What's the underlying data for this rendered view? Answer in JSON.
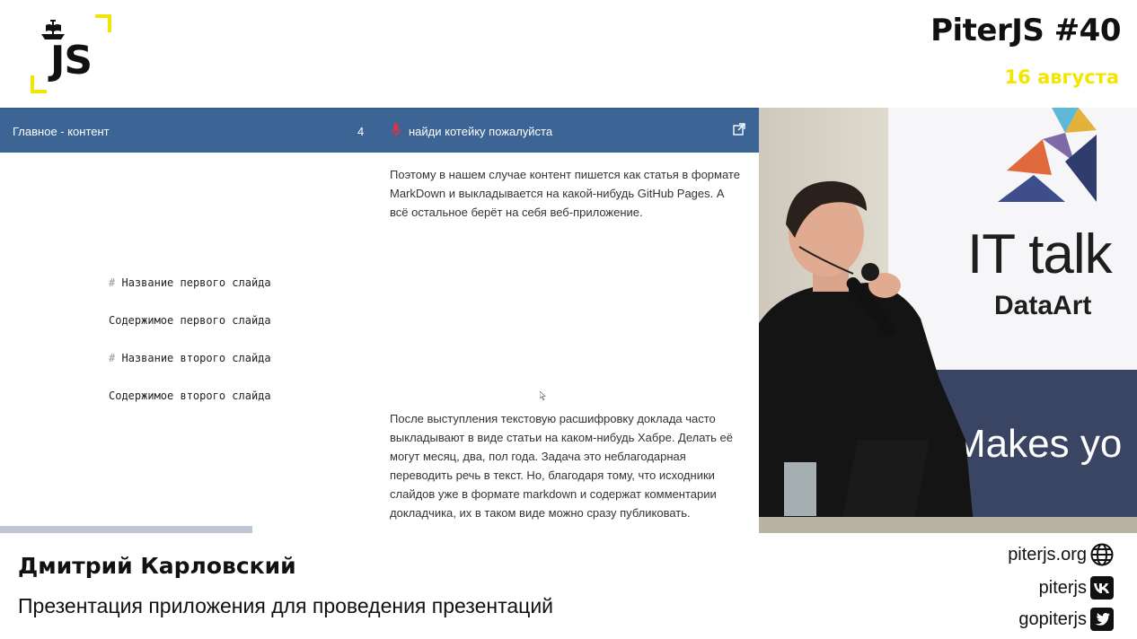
{
  "header": {
    "logo_text": "JS",
    "event_title": "PiterJS #40",
    "event_date": "16 августа"
  },
  "app": {
    "section_title": "Главное - контент",
    "slide_count": "4",
    "topic": "найди котейку пожалуйста",
    "slide_lines": [
      {
        "hash": "#",
        "text": "Название первого слайда"
      },
      {
        "hash": "",
        "text": "Содержимое первого слайда"
      },
      {
        "hash": "#",
        "text": "Название второго слайда"
      },
      {
        "hash": "",
        "text": "Содержимое второго слайда"
      }
    ],
    "notes": [
      "Поэтому в нашем случае контент пишется как статья в формате MarkDown и выкладывается на какой-нибудь GitHub Pages. А всё остальное берёт на себя веб-приложение.",
      "После выступления текстовую расшифровку доклада часто выкладывают в виде статьи на каком-нибудь Хабре. Делать её могут месяц, два, пол года. Задача это неблагодарная переводить речь в текст. Но, благодаря тому, что исходники слайдов уже в формате markdown и содержат комментарии докладчика, их в таком виде можно сразу публиковать."
    ]
  },
  "video": {
    "banner_line1": "IT talk",
    "banner_line2": "DataArt",
    "banner_line3": "Makes yo"
  },
  "footer": {
    "speaker": "Дмитрий Карловский",
    "talk_title": "Презентация приложения для проведения презентаций",
    "links": [
      {
        "label": "piterjs.org",
        "icon": "globe-icon"
      },
      {
        "label": "piterjs",
        "icon": "vk-icon"
      },
      {
        "label": "gopiterjs",
        "icon": "twitter-icon"
      }
    ]
  },
  "colors": {
    "accent_yellow": "#f2e600",
    "app_header": "#3c6595",
    "banner_dark": "#3a4463"
  }
}
